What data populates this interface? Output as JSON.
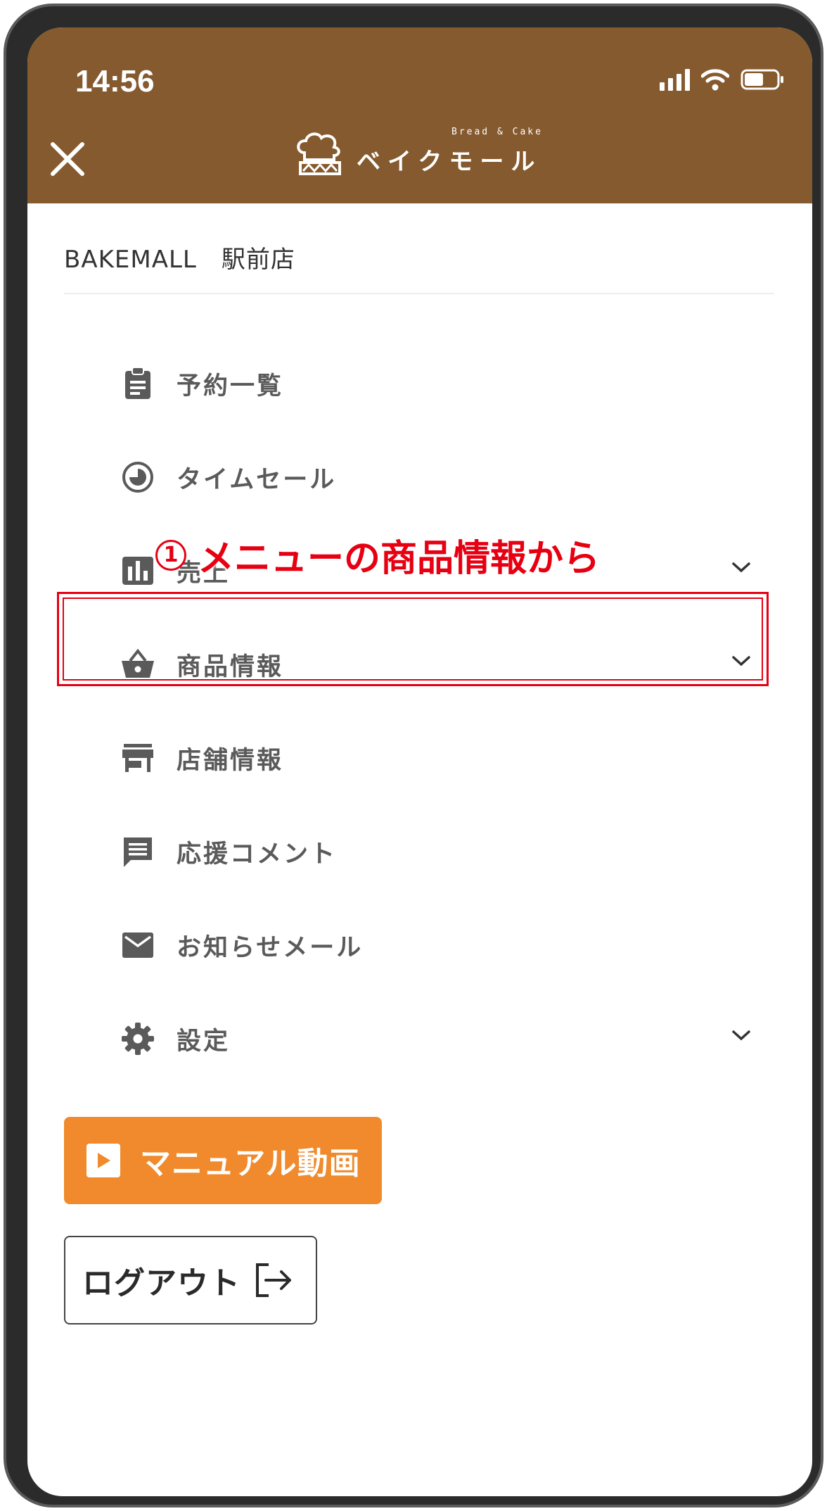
{
  "status_bar": {
    "time": "14:56"
  },
  "header": {
    "logo_small_text": "Bread & Cake",
    "logo_main_text": "ベイクモール",
    "colors": {
      "background": "#855a2f"
    }
  },
  "store": {
    "name": "BAKEMALL　駅前店"
  },
  "menu": {
    "items": [
      {
        "label": "予約一覧",
        "icon": "clipboard-icon"
      },
      {
        "label": "タイムセール",
        "icon": "timer-icon"
      },
      {
        "label": "売上",
        "icon": "bar-chart-icon",
        "expandable": true
      },
      {
        "label": "商品情報",
        "icon": "basket-icon",
        "expandable": true,
        "highlighted": true
      },
      {
        "label": "店舗情報",
        "icon": "store-icon"
      },
      {
        "label": "応援コメント",
        "icon": "comment-icon"
      },
      {
        "label": "お知らせメール",
        "icon": "mail-icon"
      },
      {
        "label": "設定",
        "icon": "gear-icon",
        "expandable": true
      }
    ]
  },
  "annotation": {
    "number": "1",
    "text": "メニューの商品情報から",
    "color": "#e60012"
  },
  "buttons": {
    "manual_label": "マニュアル動画",
    "manual_color": "#f08a2c",
    "logout_label": "ログアウト"
  }
}
